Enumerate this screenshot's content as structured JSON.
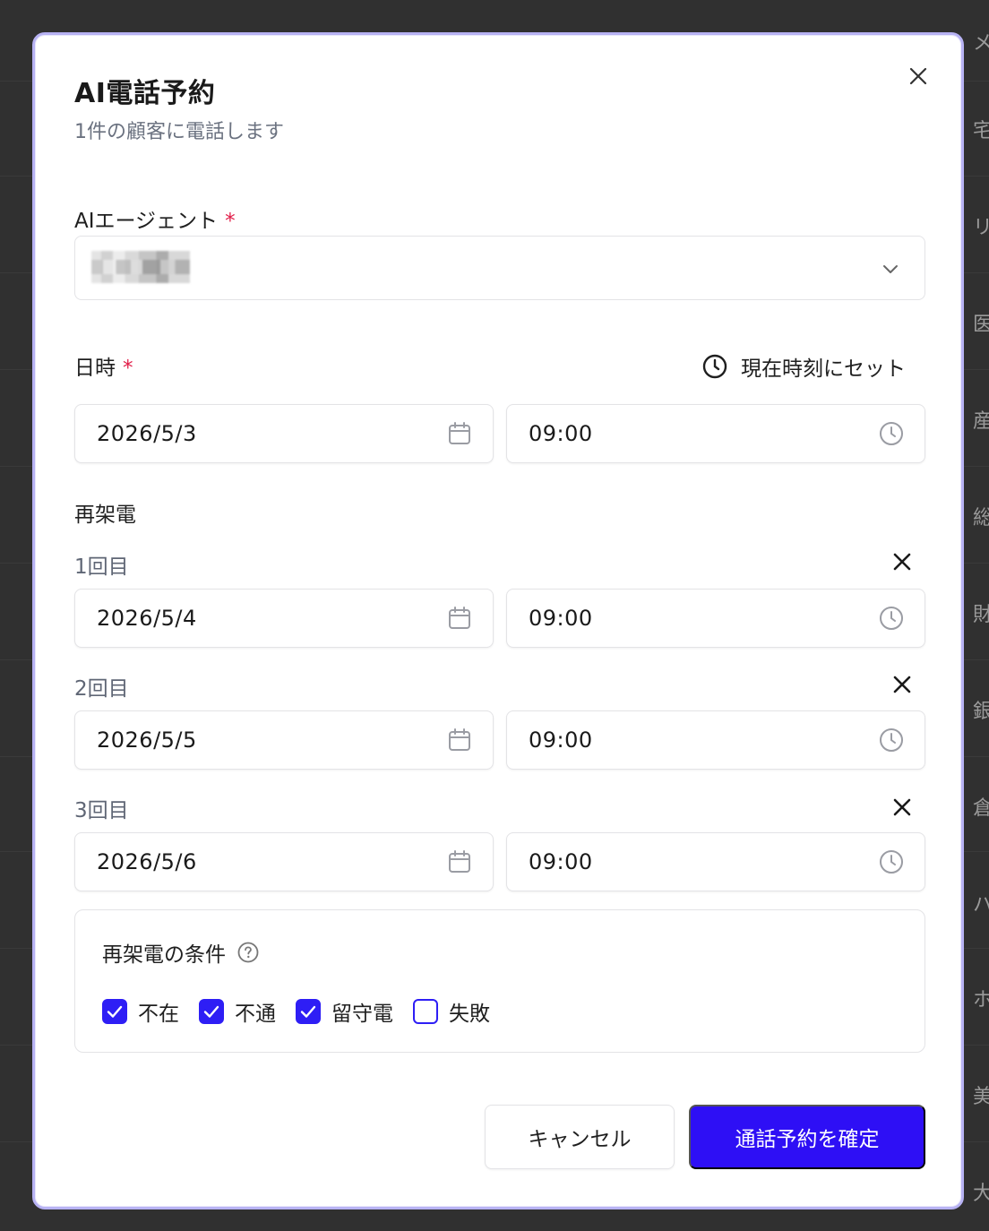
{
  "background": {
    "edge_chars": [
      "メ",
      "宅",
      "リ",
      "医",
      "産",
      "総",
      "財",
      "銀",
      "倉",
      "ハ",
      "ホ",
      "美",
      "大"
    ]
  },
  "dialog": {
    "title": "AI電話予約",
    "subtitle": "1件の顧客に電話します",
    "agent": {
      "label": "AIエージェント",
      "required_mark": "*",
      "selected_value": ""
    },
    "datetime": {
      "label": "日時",
      "required_mark": "*",
      "set_now_label": "現在時刻にセット",
      "date": "2026/5/3",
      "time": "09:00"
    },
    "retry": {
      "section_label": "再架電",
      "rows": [
        {
          "label": "1回目",
          "date": "2026/5/4",
          "time": "09:00"
        },
        {
          "label": "2回目",
          "date": "2026/5/5",
          "time": "09:00"
        },
        {
          "label": "3回目",
          "date": "2026/5/6",
          "time": "09:00"
        }
      ]
    },
    "conditions": {
      "title": "再架電の条件",
      "options": [
        {
          "label": "不在",
          "checked": true
        },
        {
          "label": "不通",
          "checked": true
        },
        {
          "label": "留守電",
          "checked": true
        },
        {
          "label": "失敗",
          "checked": false
        }
      ]
    },
    "buttons": {
      "cancel": "キャンセル",
      "confirm": "通話予約を確定"
    }
  },
  "colors": {
    "accent": "#2e0ff5",
    "required": "#e11d48",
    "dialog_border": "#b7b2f3"
  }
}
